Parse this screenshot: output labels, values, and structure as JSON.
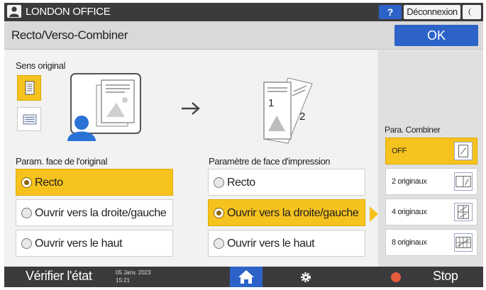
{
  "topbar": {
    "office": "LONDON OFFICE",
    "help_label": "?",
    "logout_label": "Déconnexion",
    "icons": {
      "user": "user-icon",
      "theme": "moon-icon"
    }
  },
  "header": {
    "title": "Recto/Verso-Combiner",
    "ok_label": "OK"
  },
  "original": {
    "orientation_label": "Sens original",
    "orientation_options": [
      "portrait-icon",
      "landscape-icon"
    ],
    "orientation_selected": "portrait-icon",
    "face_label": "Param. face de l'original",
    "options": [
      "Recto",
      "Ouvrir vers la droite/gauche",
      "Ouvrir vers le haut"
    ],
    "selected": "Recto"
  },
  "print": {
    "preview_labels": [
      "1",
      "2"
    ],
    "face_label": "Paramètre de face d'impression",
    "options": [
      "Recto",
      "Ouvrir vers la droite/gauche",
      "Ouvrir vers le haut"
    ],
    "selected": "Ouvrir vers la droite/gauche"
  },
  "combine": {
    "label": "Para. Combiner",
    "options": [
      "OFF",
      "2 originaux",
      "4 originaux",
      "8 originaux"
    ],
    "selected": "OFF"
  },
  "footer": {
    "check_status_label": "Vérifier l'état",
    "date": "05 Janv. 2023",
    "time": "15:21",
    "stop_label": "Stop",
    "icons": {
      "home": "home-icon",
      "settings": "gear-icon",
      "stop": "stop-icon"
    }
  },
  "colors": {
    "accent": "#f6c21e",
    "primary": "#2d63c8",
    "bar": "#3b3b3d",
    "person": "#2a72d6"
  }
}
